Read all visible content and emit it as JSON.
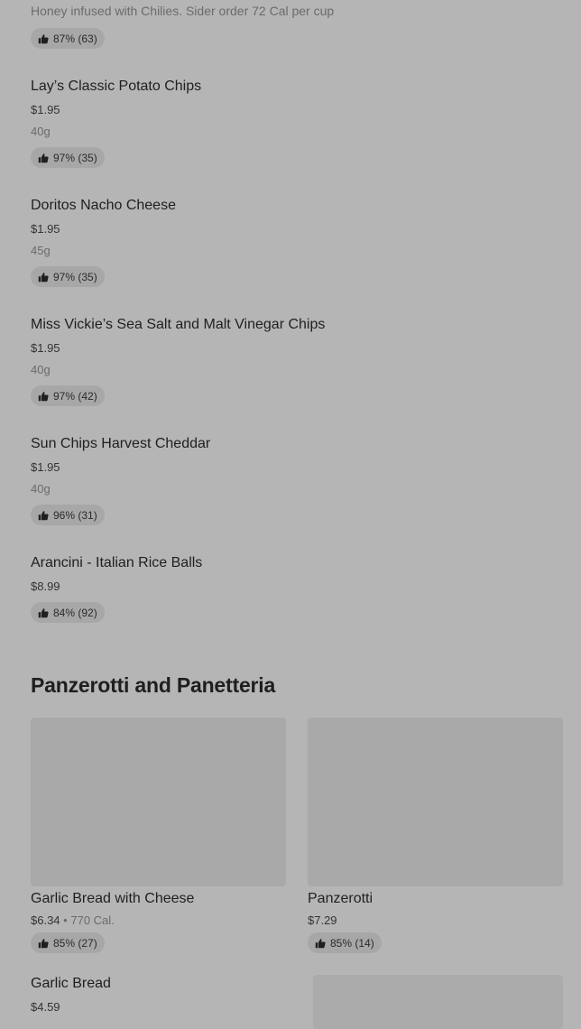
{
  "top_item": {
    "description": "Honey infused with Chilies. Sider order 72 Cal per cup",
    "rating": "87% (63)"
  },
  "items": [
    {
      "name": "Lay’s Classic Potato Chips",
      "price": "$1.95",
      "meta": "40g",
      "rating": "97% (35)"
    },
    {
      "name": "Doritos Nacho Cheese",
      "price": "$1.95",
      "meta": "45g",
      "rating": "97% (35)"
    },
    {
      "name": "Miss Vickie’s Sea Salt and Malt Vinegar Chips",
      "price": "$1.95",
      "meta": "40g",
      "rating": "97% (42)"
    },
    {
      "name": "Sun Chips Harvest Cheddar",
      "price": "$1.95",
      "meta": "40g",
      "rating": "96% (31)"
    },
    {
      "name": "Arancini - Italian Rice Balls",
      "price": "$8.99",
      "rating": "84% (92)"
    }
  ],
  "section": {
    "title": "Panzerotti and Panetteria",
    "cards": [
      {
        "name": "Garlic Bread with Cheese",
        "price": "$6.34",
        "separator": "•",
        "calories": "770 Cal.",
        "rating": "85% (27)"
      },
      {
        "name": "Panzerotti",
        "price": "$7.29",
        "rating": "85% (14)"
      }
    ],
    "next_item": {
      "name": "Garlic Bread",
      "price": "$4.59"
    }
  },
  "icons": {
    "rating": "thumbs-up-icon"
  },
  "colors": {
    "background": "#b5b5b5",
    "image_placeholder": "#a9a9a9",
    "rating_pill": "#a7a7a7"
  }
}
